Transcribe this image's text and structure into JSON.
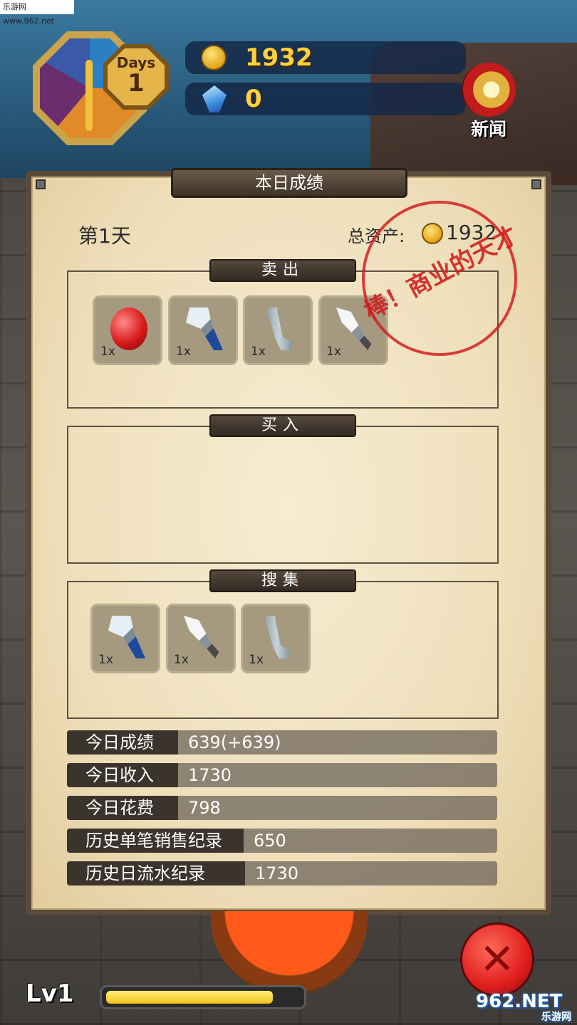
{
  "watermark_top": "乐游网 www.962.net",
  "hud": {
    "days_label": "Days",
    "day_number": "1",
    "gold": "1932",
    "gems": "0",
    "news_label": "新闻"
  },
  "panel": {
    "title": "本日成绩",
    "day_text": "第1天",
    "total_assets_label": "总资产:",
    "total_assets_value": "1932",
    "stamp_text": "棒！商业的天才",
    "sections": {
      "sell": {
        "label": "卖出",
        "items": [
          {
            "icon": "apple-icon",
            "qty": "1x"
          },
          {
            "icon": "shovel-icon",
            "qty": "1x"
          },
          {
            "icon": "pipe-icon",
            "qty": "1x"
          },
          {
            "icon": "dagger-icon",
            "qty": "1x"
          }
        ]
      },
      "buy": {
        "label": "买入",
        "items": []
      },
      "collect": {
        "label": "搜集",
        "items": [
          {
            "icon": "shovel-icon",
            "qty": "1x"
          },
          {
            "icon": "dagger-icon",
            "qty": "1x"
          },
          {
            "icon": "pipe-icon",
            "qty": "1x"
          }
        ]
      }
    },
    "stats": [
      {
        "label": "今日成绩",
        "value": "639(+639)"
      },
      {
        "label": "今日收入",
        "value": "1730"
      },
      {
        "label": "今日花费",
        "value": "798"
      },
      {
        "label": "历史单笔销售纪录",
        "value": "650"
      },
      {
        "label": "历史日流水纪录",
        "value": "1730"
      }
    ]
  },
  "bottom": {
    "level_label": "Lv1",
    "xp_progress": 0.86,
    "watermark_brand": "962.NET",
    "watermark_sub": "乐游网"
  },
  "colors": {
    "gold_text": "#ffd23a",
    "stamp_red": "#d21e1e",
    "xp_fill": "#f2c21a"
  }
}
